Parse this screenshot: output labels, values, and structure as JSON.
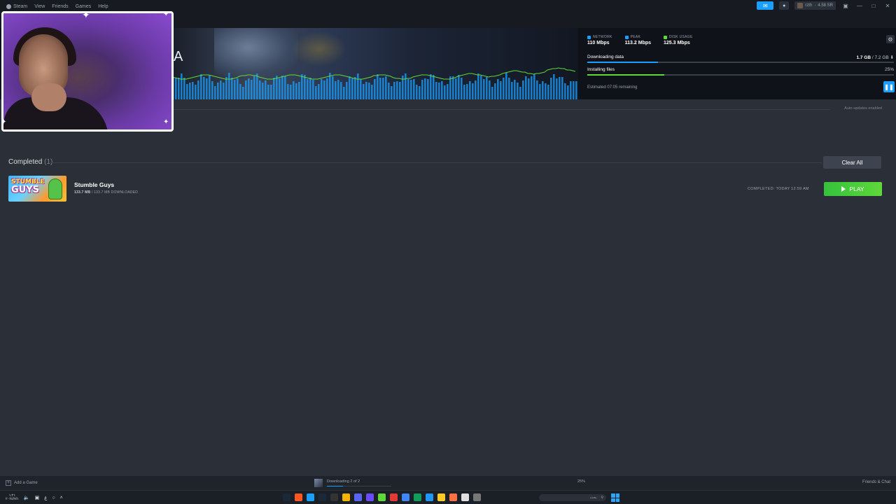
{
  "titlebar": {
    "menu": [
      "Steam",
      "View",
      "Friends",
      "Games",
      "Help"
    ],
    "user": "rzth",
    "balance": "4.58 SR",
    "window_buttons": [
      "—",
      "□",
      "✕"
    ]
  },
  "download": {
    "stats": [
      {
        "label": "NETWORK",
        "value": "110 Mbps",
        "color": "#1a9fff"
      },
      {
        "label": "PEAK",
        "value": "113.2 Mbps",
        "color": "#1a9fff"
      },
      {
        "label": "DISK USAGE",
        "value": "125.3 Mbps",
        "color": "#5fd83a"
      }
    ],
    "downloading_label": "Downloading data",
    "downloading_done": "1.7 GB",
    "downloading_total": "/ 7.2 GB",
    "downloading_progress": 0.23,
    "installing_label": "Installing files",
    "installing_pct": "25%",
    "installing_progress": 0.25,
    "eta": "Estimated 07:05 remaining",
    "auto_updates": "Auto-updates enabled",
    "banner_letter": "A"
  },
  "completed": {
    "title": "Completed",
    "count": "(1)",
    "clear_all": "Clear All",
    "items": [
      {
        "name": "Stumble Guys",
        "thumb_line1": "STUMBLE",
        "thumb_line2": "GUYS",
        "size_done": "133.7 MB",
        "size_total": "/ 133.7 MB DOWNLOADED",
        "completed_at": "COMPLETED: TODAY 12:59 AM",
        "play": "PLAY"
      }
    ]
  },
  "statusbar": {
    "add_game": "Add a Game",
    "downloading": "Downloading 2 of 2",
    "pct": "25%",
    "progress": 0.25,
    "friends": "Friends & Chat"
  },
  "taskbar": {
    "clock_line1": "١:٢١",
    "clock_line2": "٢٠٢٤/٧/١",
    "search": "بحث",
    "icon_colors": [
      "#1b2838",
      "#ff5722",
      "#1a9fff",
      "#1b2838",
      "#333333",
      "#f4b400",
      "#5865f2",
      "#6a4cff",
      "#5fd83a",
      "#e53935",
      "#4285f4",
      "#0f9d58",
      "#2196f3",
      "#ffca28",
      "#ff7043",
      "#e0e0e0",
      "#777777"
    ]
  }
}
